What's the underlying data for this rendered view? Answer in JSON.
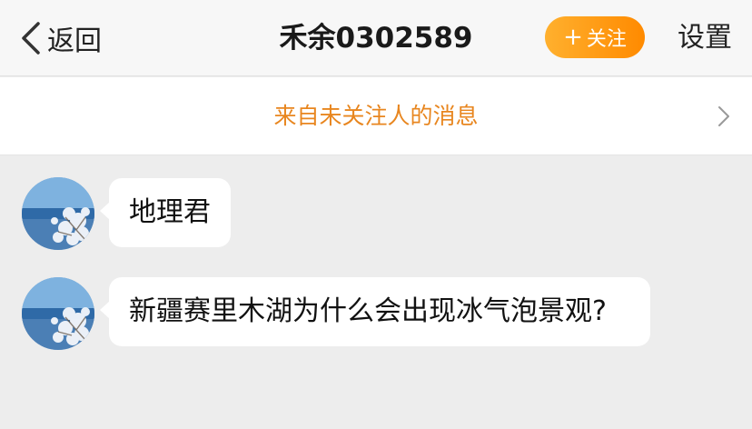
{
  "nav": {
    "back_label": "返回",
    "title": "禾余0302589",
    "follow_label": "关注",
    "follow_plus": "+",
    "settings_label": "设置",
    "accent": "#ff9a1a"
  },
  "notice": {
    "text": "来自未关注人的消息",
    "color": "#e8861f"
  },
  "messages": [
    {
      "text": "地理君"
    },
    {
      "text": "新疆赛里木湖为什么会出现冰气泡景观?"
    }
  ]
}
